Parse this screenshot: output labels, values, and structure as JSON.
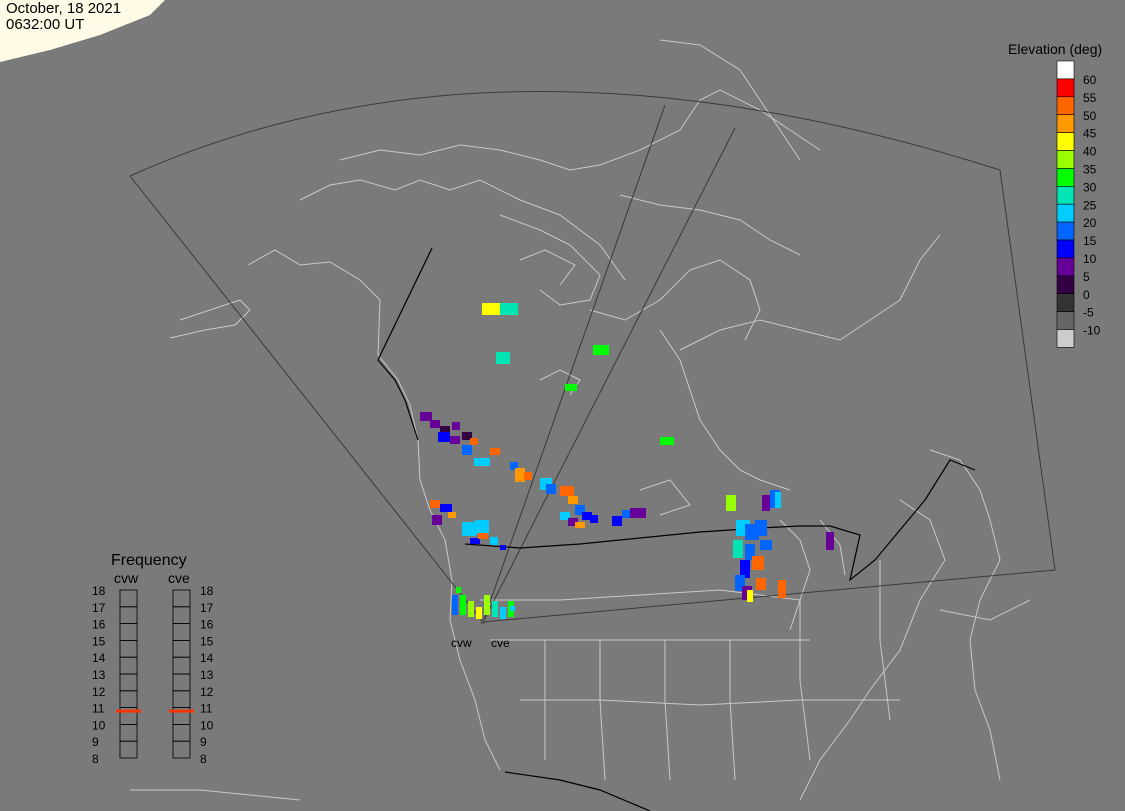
{
  "header": {
    "date": "October, 18 2021",
    "time": "0632:00 UT"
  },
  "colorbar": {
    "title": "Elevation (deg)",
    "entries": [
      {
        "label": "60",
        "color": "#ffffff"
      },
      {
        "label": "55",
        "color": "#ff0000"
      },
      {
        "label": "50",
        "color": "#ff6600"
      },
      {
        "label": "45",
        "color": "#ff9900"
      },
      {
        "label": "40",
        "color": "#ffff00"
      },
      {
        "label": "35",
        "color": "#99ff00"
      },
      {
        "label": "30",
        "color": "#00ff00"
      },
      {
        "label": "25",
        "color": "#00e5b3"
      },
      {
        "label": "20",
        "color": "#00ccff"
      },
      {
        "label": "15",
        "color": "#0066ff"
      },
      {
        "label": "10",
        "color": "#0000ff"
      },
      {
        "label": "5",
        "color": "#660099"
      },
      {
        "label": "0",
        "color": "#330044"
      },
      {
        "label": "-5",
        "color": "#333333"
      },
      {
        "label": "-10",
        "color": "#666666"
      },
      {
        "label": "",
        "color": "#cccccc"
      }
    ]
  },
  "frequency": {
    "title": "Frequency",
    "radars": [
      "cvw",
      "cve"
    ],
    "labels": [
      "18",
      "17",
      "16",
      "15",
      "14",
      "13",
      "12",
      "11",
      "10",
      "9",
      "8"
    ],
    "current": {
      "cvw": 11,
      "cve": 11
    },
    "marker_color": "#ff3300"
  },
  "radar_sites": [
    "cvw",
    "cve"
  ],
  "colors": {
    "background": "#7a7a7a",
    "coast": "#c8c8c8",
    "border": "#000000",
    "fov": "#3a3a3a",
    "daylight": "#fffbe6"
  }
}
